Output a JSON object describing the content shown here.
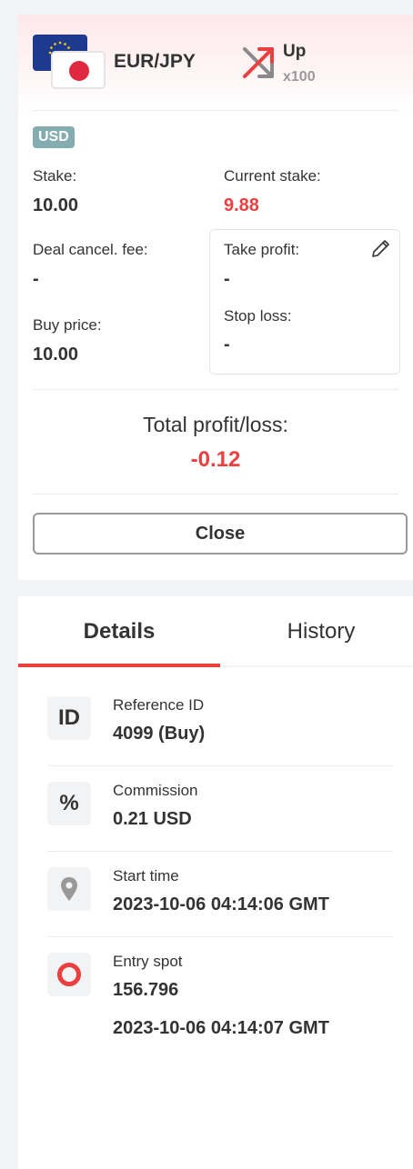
{
  "header": {
    "symbol": "EUR/JPY",
    "trade_type": "Up",
    "multiplier": "x100"
  },
  "currency": "USD",
  "stake": {
    "label": "Stake:",
    "value": "10.00"
  },
  "current_stake": {
    "label": "Current stake:",
    "value": "9.88"
  },
  "deal_cancel_fee": {
    "label": "Deal cancel. fee:",
    "value": "-"
  },
  "take_profit": {
    "label": "Take profit:",
    "value": "-"
  },
  "buy_price": {
    "label": "Buy price:",
    "value": "10.00"
  },
  "stop_loss": {
    "label": "Stop loss:",
    "value": "-"
  },
  "total_profit_loss": {
    "label": "Total profit/loss:",
    "value": "-0.12"
  },
  "close_button": "Close",
  "tabs": [
    {
      "label": "Details",
      "active": true
    },
    {
      "label": "History",
      "active": false
    }
  ],
  "details": [
    {
      "icon": "ID",
      "icon_name": "id-icon",
      "label": "Reference ID",
      "value": "4099 (Buy)"
    },
    {
      "icon": "%",
      "icon_name": "percent-icon",
      "label": "Commission",
      "value": "0.21 USD"
    },
    {
      "icon": "",
      "icon_name": "location-pin-icon",
      "label": "Start time",
      "value": "2023-10-06 04:14:06 GMT"
    },
    {
      "icon": "",
      "icon_name": "entry-spot-icon",
      "label": "Entry spot",
      "value": "156.796",
      "value2": "2023-10-06 04:14:07 GMT"
    }
  ],
  "colors": {
    "loss_red": "#ec3f3f",
    "currency_badge": "#85acb0",
    "muted": "#999999"
  }
}
